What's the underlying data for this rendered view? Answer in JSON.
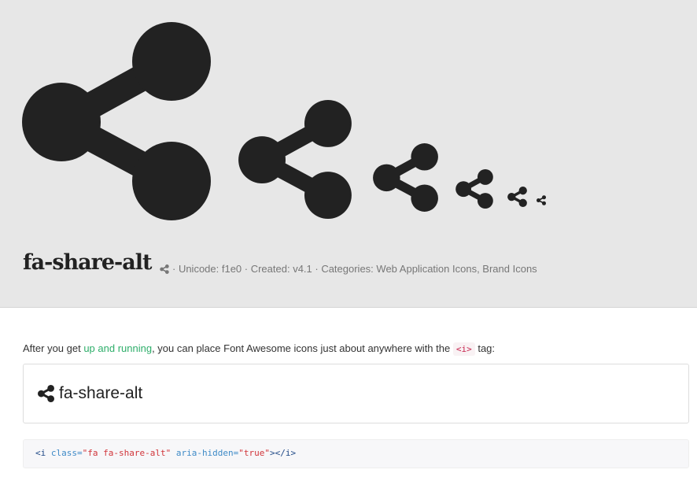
{
  "icon": {
    "name": "share-alt-icon",
    "sizes": 6
  },
  "header": {
    "title": "fa-share-alt",
    "meta": "· Unicode: f1e0 · Created: v4.1 · Categories: Web Application Icons, Brand Icons"
  },
  "intro": {
    "before": "After you get ",
    "link": "up and running",
    "after": ", you can place Font Awesome icons just about anywhere with the ",
    "tag": "<i>",
    "end": " tag:"
  },
  "example": {
    "label": "fa-share-alt"
  },
  "code": {
    "open": "<i",
    "attr1": " class=",
    "val1": "\"fa fa-share-alt\"",
    "attr2": " aria-hidden=",
    "val2": "\"true\"",
    "close": "></i>"
  },
  "colors": {
    "link": "#2eae6a",
    "code_tag": "#c7254e",
    "hero_bg": "#e7e7e7"
  }
}
